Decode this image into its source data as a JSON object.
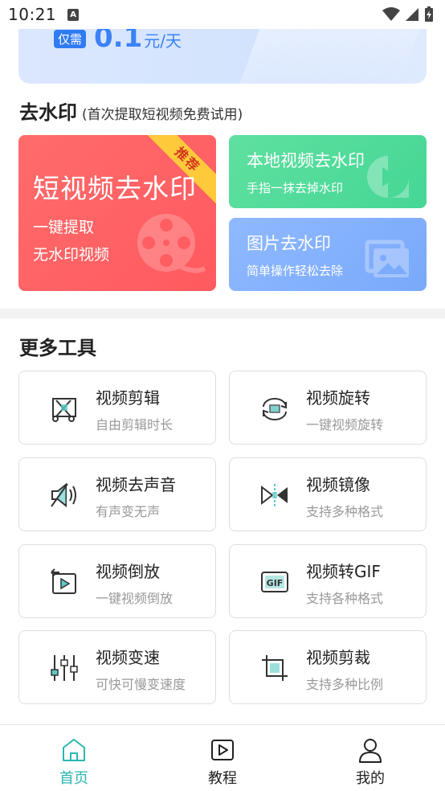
{
  "status_bar": {
    "time": "10:21",
    "notif_letter": "A"
  },
  "banner": {
    "badge": "仅需",
    "amount": "0.1",
    "unit": "元/天"
  },
  "watermark_section": {
    "title": "去水印",
    "subtitle": "(首次提取短视频免费试用)",
    "main_card": {
      "title": "短视频去水印",
      "line1": "一键提取",
      "line2": "无水印视频",
      "ribbon": "推荐"
    },
    "local_card": {
      "title": "本地视频去水印",
      "subtitle": "手指一抹去掉水印"
    },
    "image_card": {
      "title": "图片去水印",
      "subtitle": "简单操作轻松去除"
    }
  },
  "tools_section": {
    "title": "更多工具",
    "items": [
      {
        "name": "视频剪辑",
        "desc": "自由剪辑时长",
        "icon": "scissors-icon"
      },
      {
        "name": "视频旋转",
        "desc": "一键视频旋转",
        "icon": "rotate-icon"
      },
      {
        "name": "视频去声音",
        "desc": "有声变无声",
        "icon": "speaker-icon"
      },
      {
        "name": "视频镜像",
        "desc": "支持多种格式",
        "icon": "mirror-icon"
      },
      {
        "name": "视频倒放",
        "desc": "一键视频倒放",
        "icon": "reverse-icon"
      },
      {
        "name": "视频转GIF",
        "desc": "支持各种格式",
        "icon": "gif-icon"
      },
      {
        "name": "视频变速",
        "desc": "可快可慢变速度",
        "icon": "sliders-icon"
      },
      {
        "name": "视频剪裁",
        "desc": "支持多种比例",
        "icon": "crop-icon"
      }
    ]
  },
  "bottom_nav": {
    "items": [
      {
        "label": "首页",
        "icon": "home-icon",
        "active": true
      },
      {
        "label": "教程",
        "icon": "play-icon",
        "active": false
      },
      {
        "label": "我的",
        "icon": "user-icon",
        "active": false
      }
    ]
  },
  "colors": {
    "accent": "#2bb6b0",
    "red_card": "#ff5a5f",
    "green_card": "#45d695",
    "blue_card": "#7aa9fb",
    "ribbon": "#ffc93c"
  }
}
